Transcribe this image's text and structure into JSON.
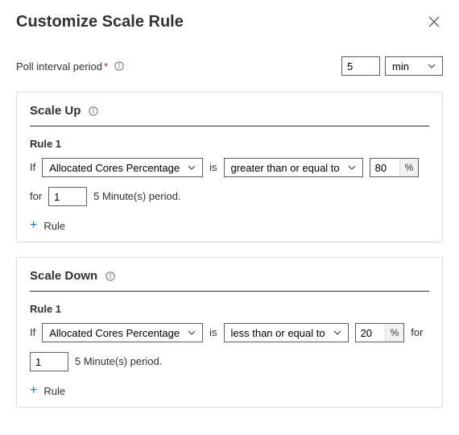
{
  "header": {
    "title": "Customize Scale Rule"
  },
  "poll": {
    "label": "Poll interval period",
    "value": "5",
    "unit": "min"
  },
  "common": {
    "if_text": "If",
    "is_text": "is",
    "for_text": "for",
    "add_rule_label": "Rule"
  },
  "scale_up": {
    "title": "Scale Up",
    "rule_label": "Rule 1",
    "metric": "Allocated Cores Percentage",
    "operator": "greater than or equal to",
    "threshold": "80",
    "periods": "1",
    "period_text": "5 Minute(s) period."
  },
  "scale_down": {
    "title": "Scale Down",
    "rule_label": "Rule 1",
    "metric": "Allocated Cores Percentage",
    "operator": "less than or equal to",
    "threshold": "20",
    "periods": "1",
    "period_text": "5 Minute(s) period."
  }
}
